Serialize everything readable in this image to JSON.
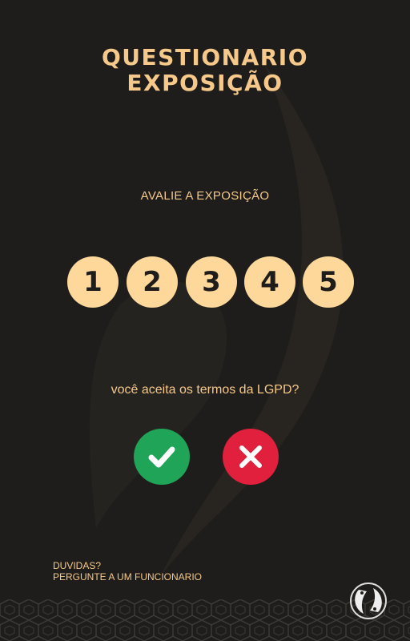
{
  "header": {
    "title_line1": "QUESTIONARIO",
    "title_line2": "EXPOSIÇÃO"
  },
  "rating": {
    "prompt": "AVALIE A EXPOSIÇÃO",
    "options": [
      "1",
      "2",
      "3",
      "4",
      "5"
    ]
  },
  "consent": {
    "question": "você aceita os termos da LGPD?",
    "accept_icon": "check-icon",
    "decline_icon": "x-icon"
  },
  "footer": {
    "line1": "DUVIDAS?",
    "line2": "PERGUNTE A UM FUNCIONARIO"
  },
  "colors": {
    "accent": "#f6c98a",
    "button_fill": "#fdd89a",
    "accept": "#1fa458",
    "decline": "#e0203d",
    "background": "#1e1d1b"
  },
  "logo_icon": "koi-fish-icon"
}
